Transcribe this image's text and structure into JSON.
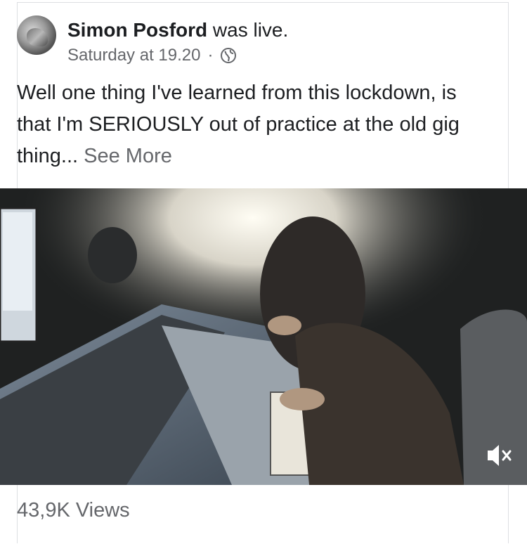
{
  "post": {
    "author": "Simon Posford",
    "action": "was live.",
    "timestamp": "Saturday at 19.20",
    "separator": "·",
    "privacy_icon": "globe-icon",
    "text": "Well one thing I've learned from this lockdown, is that I'm SERIOUSLY out of practice at the old gig thing...",
    "see_more": "See More"
  },
  "video": {
    "mute_icon": "muted-speaker-icon",
    "scene": "studio mixing console with musician"
  },
  "stats": {
    "views": "43,9K Views"
  }
}
